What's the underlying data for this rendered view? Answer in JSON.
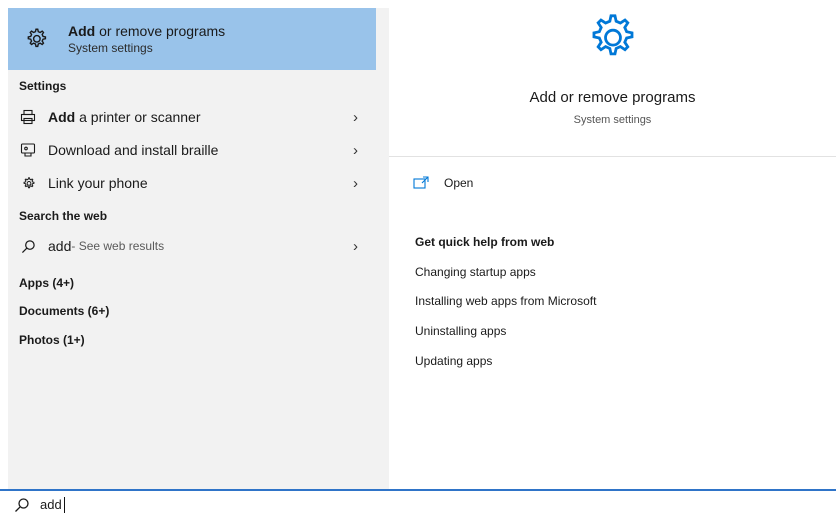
{
  "best_match": {
    "title_bold": "Add",
    "title_rest": " or remove programs",
    "subtitle": "System settings"
  },
  "sections": {
    "settings": "Settings",
    "search_web": "Search the web",
    "apps": "Apps (4+)",
    "documents": "Documents (6+)",
    "photos": "Photos (1+)"
  },
  "settings_items": [
    {
      "bold": "Add",
      "rest": " a printer or scanner",
      "icon": "printer-icon"
    },
    {
      "bold": "",
      "rest": "Download and install braille",
      "icon": "braille-icon"
    },
    {
      "bold": "",
      "rest": "Link your phone",
      "icon": "gear-icon"
    }
  ],
  "web_result": {
    "query": "add",
    "suffix": " - See web results",
    "icon": "search-icon"
  },
  "preview": {
    "title": "Add or remove programs",
    "subtitle": "System settings",
    "open_label": "Open",
    "quick_help_heading": "Get quick help from web",
    "help_links": [
      "Changing startup apps",
      "Installing web apps from Microsoft",
      "Uninstalling apps",
      "Updating apps"
    ]
  },
  "search": {
    "value": "add"
  },
  "colors": {
    "highlight": "#99c3ea",
    "accent": "#0078d7",
    "search_border": "#2f74c8"
  }
}
